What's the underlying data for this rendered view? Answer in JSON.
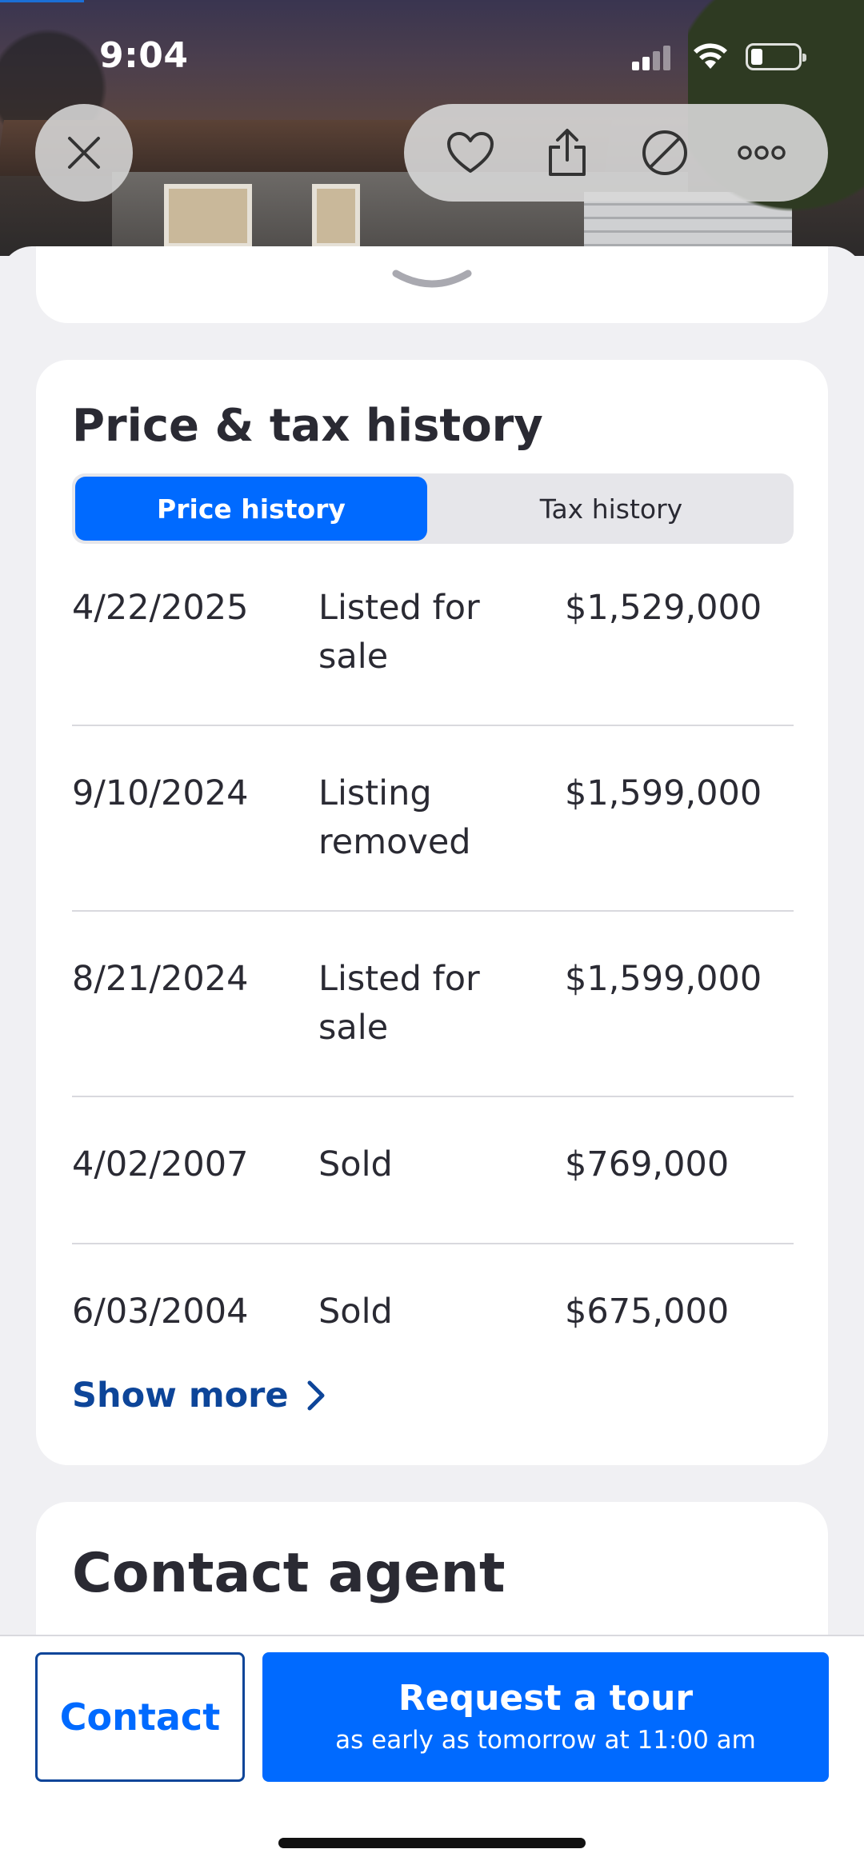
{
  "status_bar": {
    "time": "9:04"
  },
  "price_card": {
    "title": "Price & tax history",
    "tabs": {
      "active": "Price history",
      "inactive": "Tax history"
    },
    "rows": [
      {
        "date": "4/22/2025",
        "event": "Listed for sale",
        "price": "$1,529,000"
      },
      {
        "date": "9/10/2024",
        "event": "Listing removed",
        "price": "$1,599,000"
      },
      {
        "date": "8/21/2024",
        "event": "Listed for sale",
        "price": "$1,599,000"
      },
      {
        "date": "4/02/2007",
        "event": "Sold",
        "price": "$769,000"
      },
      {
        "date": "6/03/2004",
        "event": "Sold",
        "price": "$675,000"
      }
    ],
    "show_more": "Show more"
  },
  "contact_card": {
    "title": "Contact agent"
  },
  "bottom_bar": {
    "contact": "Contact",
    "tour_title": "Request a tour",
    "tour_subtitle": "as early as tomorrow at 11:00 am"
  },
  "colors": {
    "accent": "#006aff",
    "link": "#0d4599",
    "text": "#2a2a33",
    "background": "#f0f0f3"
  },
  "icons": [
    "close-icon",
    "heart-icon",
    "share-icon",
    "hide-icon",
    "more-icon",
    "chevron-down-icon",
    "chevron-right-icon"
  ]
}
